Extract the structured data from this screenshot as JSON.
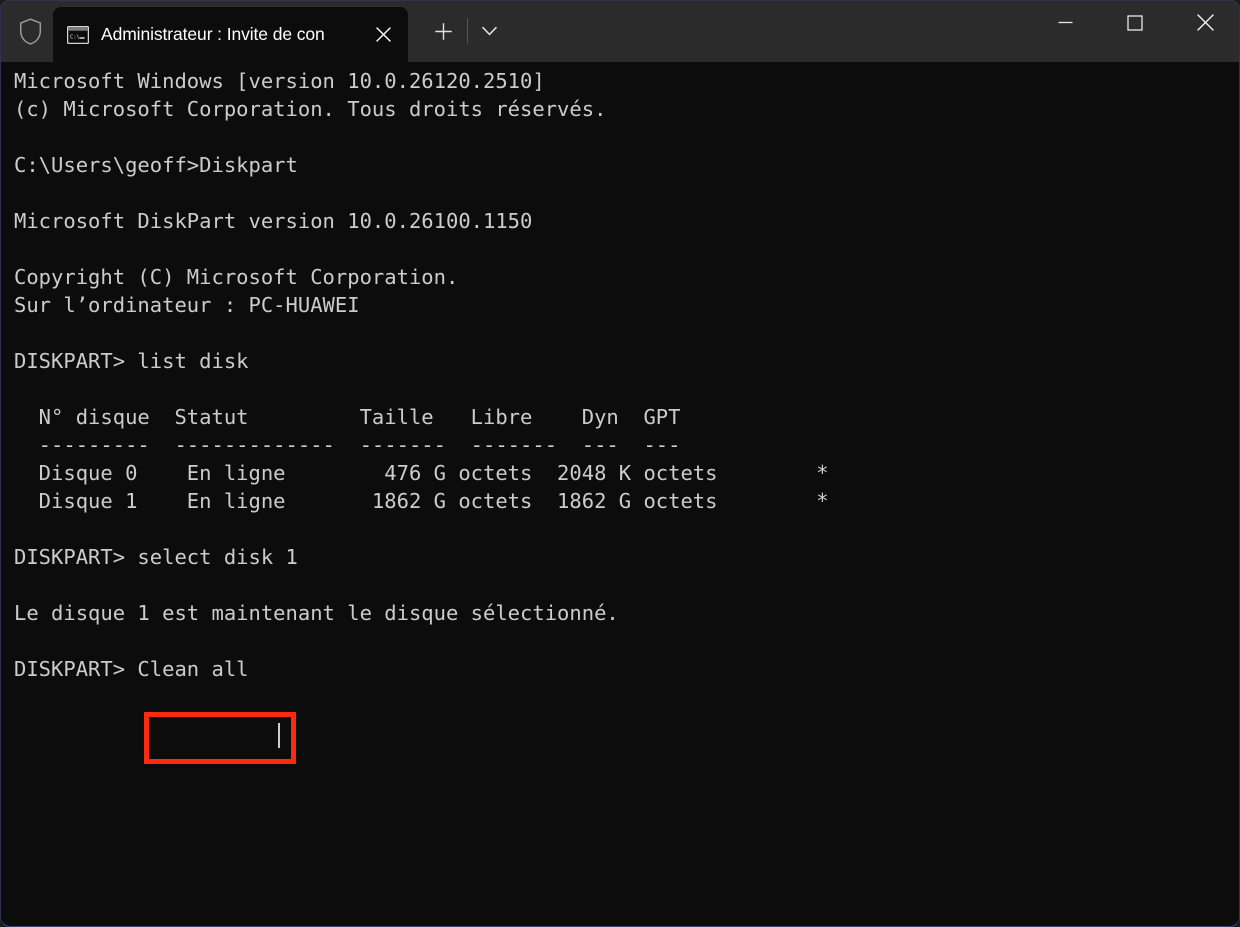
{
  "window": {
    "accent_border_color": "#3a4478",
    "titlebar_bg": "#2b2b2b",
    "console_bg": "#0c0c0c",
    "console_fg": "#cccccc",
    "annotation_color": "#fc2a12"
  },
  "titlebar": {
    "shield_icon": "shield-icon",
    "tab": {
      "icon": "console-window-icon",
      "title": "Administrateur : Invite de con",
      "close_label": "✕",
      "close_icon": "close-icon"
    },
    "new_tab_label": "+",
    "new_tab_icon": "plus-icon",
    "dropdown_icon": "chevron-down-icon",
    "window_controls": {
      "minimize_icon": "minimize-icon",
      "maximize_icon": "maximize-icon",
      "close_icon": "close-icon"
    }
  },
  "console": {
    "lines": [
      "Microsoft Windows [version 10.0.26120.2510]",
      "(c) Microsoft Corporation. Tous droits réservés.",
      "",
      "C:\\Users\\geoff>Diskpart",
      "",
      "Microsoft DiskPart version 10.0.26100.1150",
      "",
      "Copyright (C) Microsoft Corporation.",
      "Sur l’ordinateur : PC-HUAWEI",
      "",
      "DISKPART> list disk",
      "",
      "  N° disque  Statut         Taille   Libre    Dyn  GPT",
      "  ---------  -------------  -------  -------  ---  ---",
      "  Disque 0    En ligne        476 G octets  2048 K octets        *",
      "  Disque 1    En ligne       1862 G octets  1862 G octets        *",
      "",
      "DISKPART> select disk 1",
      "",
      "Le disque 1 est maintenant le disque sélectionné.",
      "",
      "DISKPART> Clean all"
    ],
    "text": "Microsoft Windows [version 10.0.26120.2510]\n(c) Microsoft Corporation. Tous droits réservés.\n\nC:\\Users\\geoff>Diskpart\n\nMicrosoft DiskPart version 10.0.26100.1150\n\nCopyright (C) Microsoft Corporation.\nSur l’ordinateur : PC-HUAWEI\n\nDISKPART> list disk\n\n  N° disque  Statut         Taille   Libre    Dyn  GPT\n  ---------  -------------  -------  -------  ---  ---\n  Disque 0    En ligne        476 G octets  2048 K octets        *\n  Disque 1    En ligne       1862 G octets  1862 G octets        *\n\nDISKPART> select disk 1\n\nLe disque 1 est maintenant le disque sélectionné.\n\nDISKPART> Clean all",
    "disk_table": {
      "headers": [
        "N° disque",
        "Statut",
        "Taille",
        "Libre",
        "Dyn",
        "GPT"
      ],
      "rows": [
        {
          "disk": "Disque 0",
          "status": "En ligne",
          "size": "476 G octets",
          "free": "2048 K octets",
          "dyn": "",
          "gpt": "*"
        },
        {
          "disk": "Disque 1",
          "status": "En ligne",
          "size": "1862 G octets",
          "free": "1862 G octets",
          "dyn": "",
          "gpt": "*"
        }
      ]
    },
    "commands": [
      "Diskpart",
      "list disk",
      "select disk 1",
      "Clean all"
    ],
    "prompt": "DISKPART>",
    "current_input": "Clean all",
    "diskpart_version": "10.0.26100.1150",
    "windows_version": "10.0.26120.2510",
    "computer_name": "PC-HUAWEI",
    "user_path": "C:\\Users\\geoff"
  },
  "annotation": {
    "highlighted_text": "Clean all",
    "color": "#fc2a12"
  }
}
